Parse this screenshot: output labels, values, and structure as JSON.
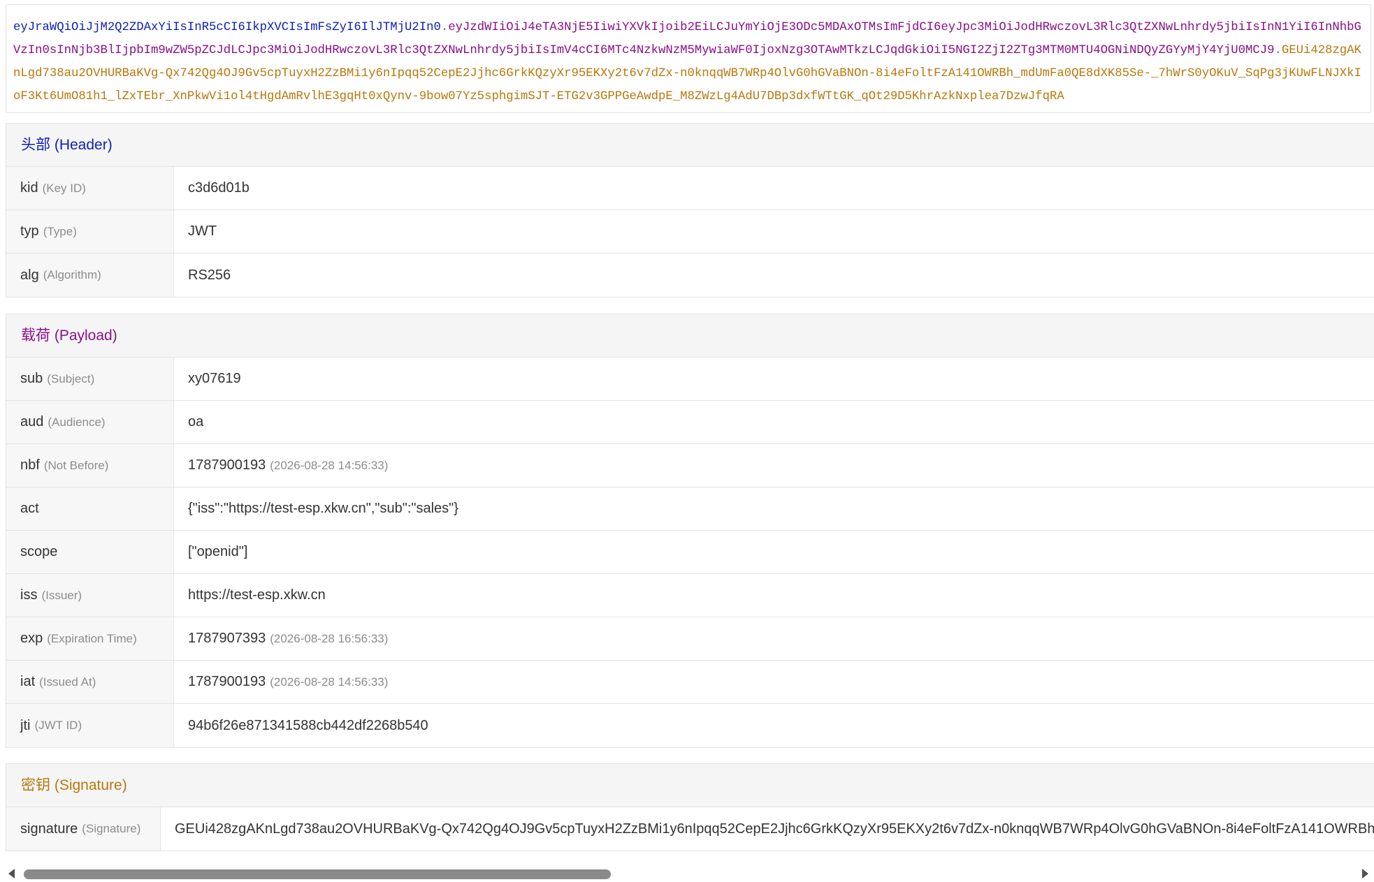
{
  "token": {
    "header_part": "eyJraWQiOiJjM2Q2ZDAxYiIsInR5cCI6IkpXVCIsImFsZyI6IlJTMjU2In0",
    "dot": ".",
    "payload_part": "eyJzdWIiOiJ4eTA3NjE5IiwiYXVkIjoib2EiLCJuYmYiOjE3ODc5MDAxOTMsImFjdCI6eyJpc3MiOiJodHRwczovL3Rlc3QtZXNwLnhrdy5jbiIsInN1YiI6InNhbGVzIn0sInNjb3BlIjpbIm9wZW5pZCJdLCJpc3MiOiJodHRwczovL3Rlc3QtZXNwLnhrdy5jbiIsImV4cCI6MTc4NzkwNzM5MywiaWF0IjoxNzg3OTAwMTkzLCJqdGkiOiI5NGI2ZjI2ZTg3MTM0MTU4OGNiNDQyZGYyMjY4YjU0MCJ9",
    "signature_part": "GEUi428zgAKnLgd738au2OVHURBaKVg-Qx742Qg4OJ9Gv5cpTuyxH2ZzBMi1y6nIpqq52CepE2Jjhc6GrkKQzyXr95EKXy2t6v7dZx-n0knqqWB7WRp4OlvG0hGVaBNOn-8i4eFoltFzA141OWRBh_mdUmFa0QE8dXK85Se-_7hWrS0yOKuV_SqPg3jKUwFLNJXkIoF3Kt6UmO81h1_lZxTEbr_XnPkwVi1ol4tHgdAmRvlhE3gqHt0xQynv-9bow07Yz5sphgimSJT-ETG2v3GPPGeAwdpE_M8ZWzLg4AdU7DBp3dxfWTtGK_qOt29D5KhrAzkNxplea7DzwJfqRA"
  },
  "header": {
    "title": "头部 (Header)",
    "rows": [
      {
        "key": "kid",
        "desc": "(Key ID)",
        "value": "c3d6d01b",
        "time": ""
      },
      {
        "key": "typ",
        "desc": "(Type)",
        "value": "JWT",
        "time": ""
      },
      {
        "key": "alg",
        "desc": "(Algorithm)",
        "value": "RS256",
        "time": ""
      }
    ]
  },
  "payload": {
    "title": "载荷 (Payload)",
    "rows": [
      {
        "key": "sub",
        "desc": "(Subject)",
        "value": "xy07619",
        "time": ""
      },
      {
        "key": "aud",
        "desc": "(Audience)",
        "value": "oa",
        "time": ""
      },
      {
        "key": "nbf",
        "desc": "(Not Before)",
        "value": "1787900193",
        "time": "(2026-08-28 14:56:33)"
      },
      {
        "key": "act",
        "desc": "",
        "value": "{\"iss\":\"https://test-esp.xkw.cn\",\"sub\":\"sales\"}",
        "time": ""
      },
      {
        "key": "scope",
        "desc": "",
        "value": "[\"openid\"]",
        "time": ""
      },
      {
        "key": "iss",
        "desc": "(Issuer)",
        "value": "https://test-esp.xkw.cn",
        "time": ""
      },
      {
        "key": "exp",
        "desc": "(Expiration Time)",
        "value": "1787907393",
        "time": "(2026-08-28 16:56:33)"
      },
      {
        "key": "iat",
        "desc": "(Issued At)",
        "value": "1787900193",
        "time": "(2026-08-28 14:56:33)"
      },
      {
        "key": "jti",
        "desc": "(JWT ID)",
        "value": "94b6f26e871341588cb442df2268b540",
        "time": ""
      }
    ]
  },
  "signature": {
    "title": "密钥 (Signature)",
    "rows": [
      {
        "key": "signature",
        "desc": "(Signature)",
        "value": "GEUi428zgAKnLgd738au2OVHURBaKVg-Qx742Qg4OJ9Gv5cpTuyxH2ZzBMi1y6nIpqq52CepE2Jjhc6GrkKQzyXr95EKXy2t6v7dZx-n0knqqWB7WRp4OlvG0hGVaBNOn-8i4eFoltFzA141OWRBh_mdUmFa0QE8dXK85Se-_7hWrS0yOKuV_SqPg3jKUwFLNJXkIoF3Kt6UmO81h1_lZxTEbr_XnPkwVi1ol4tHgdAmRvlhE3gqHt0xQynv-9bow07Yz5sphgimSJT-ETG2v3GPPGeAwdpE_M8ZWzLg4AdU7DBp3dxfWTtGK_qOt29D5KhrAzkNxplea7DzwJfqRA",
        "time": ""
      }
    ]
  },
  "colors": {
    "header": "#0b1fb8",
    "payload": "#8a0f8a",
    "signature": "#b8780c"
  }
}
